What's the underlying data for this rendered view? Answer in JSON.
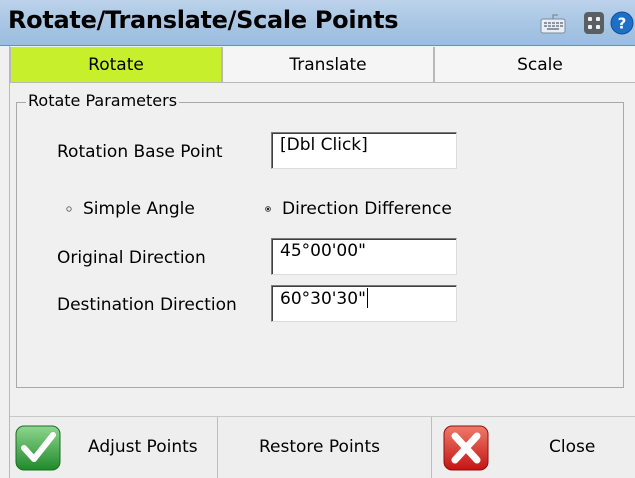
{
  "window": {
    "title": "Rotate/Translate/Scale Points",
    "icons": [
      "keyboard-icon",
      "calculator-icon",
      "help-icon"
    ]
  },
  "tabs": [
    {
      "label": "Rotate",
      "active": true
    },
    {
      "label": "Translate",
      "active": false
    },
    {
      "label": "Scale",
      "active": false
    }
  ],
  "rotate": {
    "group_label": "Rotate Parameters",
    "base_point_label": "Rotation Base Point",
    "base_point_value": "[Dbl Click]",
    "mode_options": [
      {
        "label": "Simple Angle",
        "selected": false
      },
      {
        "label": "Direction Difference",
        "selected": true
      }
    ],
    "original_direction_label": "Original Direction",
    "original_direction_value": "45°00'00\"",
    "destination_direction_label": "Destination Direction",
    "destination_direction_value": "60°30'30\""
  },
  "buttons": {
    "adjust_label": "Adjust Points",
    "restore_label": "Restore Points",
    "close_label": "Close"
  },
  "colors": {
    "active_tab": "#c7ef2b",
    "title_bar": "#a9c6e4",
    "check_green": "#2e9c2e",
    "close_red": "#d82020"
  }
}
